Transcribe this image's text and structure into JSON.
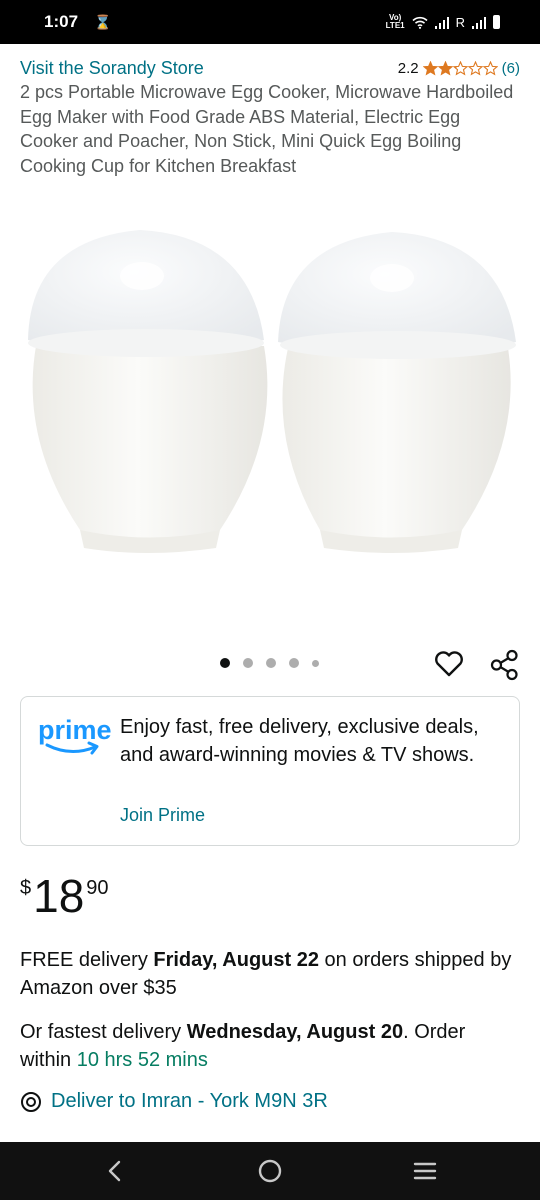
{
  "status_bar": {
    "time": "1:07",
    "network_label": "Vo) LTE1",
    "roaming_label": "R"
  },
  "store": {
    "link_text": "Visit the Sorandy Store",
    "rating_value": "2.2",
    "rating_stars": 2.2,
    "rating_count": "(6)"
  },
  "product": {
    "title": "2 pcs Portable Microwave Egg Cooker, Microwave Hardboiled Egg Maker with Food Grade ABS Material, Electric Egg Cooker and Poacher, Non Stick, Mini Quick Egg Boiling Cooking Cup for Kitchen Breakfast",
    "image_count": 5,
    "active_image": 1
  },
  "prime": {
    "logo_text": "prime",
    "promo_text": "Enjoy fast, free delivery, exclusive deals, and award-winning movies & TV shows.",
    "join_label": "Join Prime"
  },
  "price": {
    "symbol": "$",
    "whole": "18",
    "fraction": "90"
  },
  "delivery": {
    "free_prefix": "FREE delivery ",
    "free_date": "Friday, August 22",
    "free_suffix": " on orders shipped by Amazon over $35",
    "fastest_prefix": "Or fastest delivery ",
    "fastest_date": "Wednesday, August 20",
    "fastest_middle": ". Order within ",
    "fastest_countdown": "10 hrs 52 mins",
    "deliver_to": "Deliver to Imran - York M9N 3R"
  },
  "colors": {
    "link": "#007185",
    "star": "#de7921",
    "countdown": "#067d62",
    "prime_blue": "#1a98ff",
    "cutoff_red": "#b12704"
  },
  "icons": {
    "wishlist": "heart-icon",
    "share": "share-icon",
    "location": "location-pin-icon",
    "nav_back": "back-icon",
    "nav_home": "home-icon",
    "nav_menu": "menu-icon"
  }
}
